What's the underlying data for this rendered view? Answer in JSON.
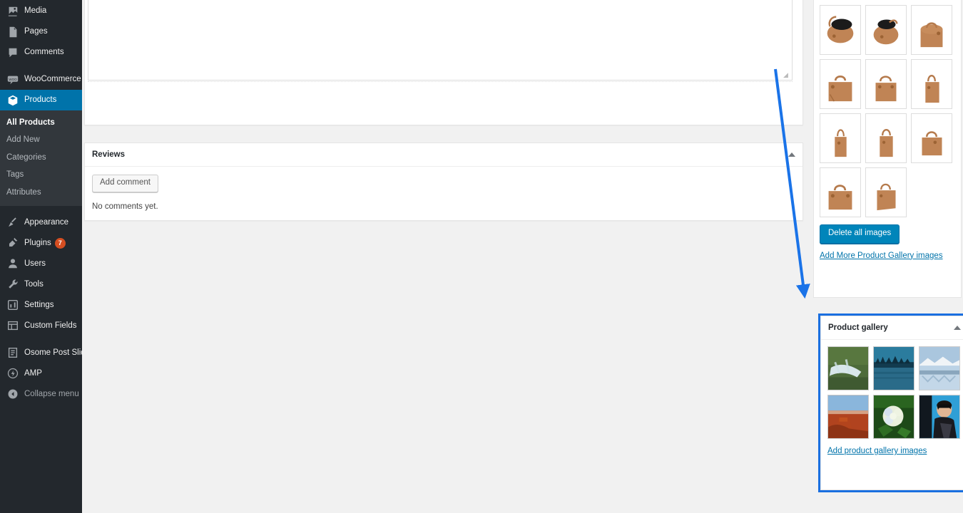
{
  "sidebar": {
    "items": [
      {
        "label": "Media",
        "icon": "media-icon",
        "state": "normal"
      },
      {
        "label": "Pages",
        "icon": "pages-icon",
        "state": "normal"
      },
      {
        "label": "Comments",
        "icon": "comments-icon",
        "state": "normal"
      },
      {
        "label": "WooCommerce",
        "icon": "woocommerce-icon",
        "state": "normal"
      },
      {
        "label": "Products",
        "icon": "products-icon",
        "state": "current"
      },
      {
        "label": "Appearance",
        "icon": "appearance-icon",
        "state": "normal"
      },
      {
        "label": "Plugins",
        "icon": "plugins-icon",
        "state": "normal",
        "badge": "7"
      },
      {
        "label": "Users",
        "icon": "users-icon",
        "state": "normal"
      },
      {
        "label": "Tools",
        "icon": "tools-icon",
        "state": "normal"
      },
      {
        "label": "Settings",
        "icon": "settings-icon",
        "state": "normal"
      },
      {
        "label": "Custom Fields",
        "icon": "custom-fields-icon",
        "state": "normal"
      },
      {
        "label": "Osome Post Slider",
        "icon": "osome-post-slider-icon",
        "state": "normal"
      },
      {
        "label": "AMP",
        "icon": "amp-icon",
        "state": "normal"
      },
      {
        "label": "Collapse menu",
        "icon": "collapse-icon",
        "state": "dim"
      }
    ],
    "submenu": [
      {
        "label": "All Products",
        "current": true
      },
      {
        "label": "Add New",
        "current": false
      },
      {
        "label": "Categories",
        "current": false
      },
      {
        "label": "Tags",
        "current": false
      },
      {
        "label": "Attributes",
        "current": false
      }
    ]
  },
  "editor": {
    "value": "",
    "placeholder": ""
  },
  "reviews": {
    "title": "Reviews",
    "add_comment_label": "Add comment",
    "empty_text": "No comments yet.",
    "toggle": "toggle-panel"
  },
  "product_images": {
    "delete_all_label": "Delete all images",
    "add_more_label": "Add More Product Gallery images",
    "thumbnails": [
      {
        "alt": "handbag-open-top-view"
      },
      {
        "alt": "handbag-open-angled"
      },
      {
        "alt": "handbag-front-handles-up"
      },
      {
        "alt": "handbag-front-view"
      },
      {
        "alt": "handbag-three-quarter"
      },
      {
        "alt": "handbag-side-view"
      },
      {
        "alt": "handbag-side-narrow"
      },
      {
        "alt": "handbag-angled-left"
      },
      {
        "alt": "handbag-angled-right"
      },
      {
        "alt": "handbag-front-wide"
      },
      {
        "alt": "handbag-rear-view"
      }
    ]
  },
  "product_gallery": {
    "title": "Product gallery",
    "add_link_label": "Add product gallery images",
    "toggle": "toggle-panel",
    "thumbnails": [
      {
        "alt": "waterfall-landscape"
      },
      {
        "alt": "dark-forest-lake"
      },
      {
        "alt": "snowy-mountain-lake"
      },
      {
        "alt": "red-rock-desert-butte"
      },
      {
        "alt": "white-hydrangea-flower"
      },
      {
        "alt": "woman-with-sunglasses"
      }
    ]
  },
  "colors": {
    "accent": "#0073aa",
    "primary_button": "#0085ba",
    "highlight_outline": "#1a6fe0",
    "annotation_arrow": "#1a73e8",
    "badge": "#d54e21",
    "sidebar_bg": "#23282d",
    "submenu_bg": "#32373c"
  }
}
